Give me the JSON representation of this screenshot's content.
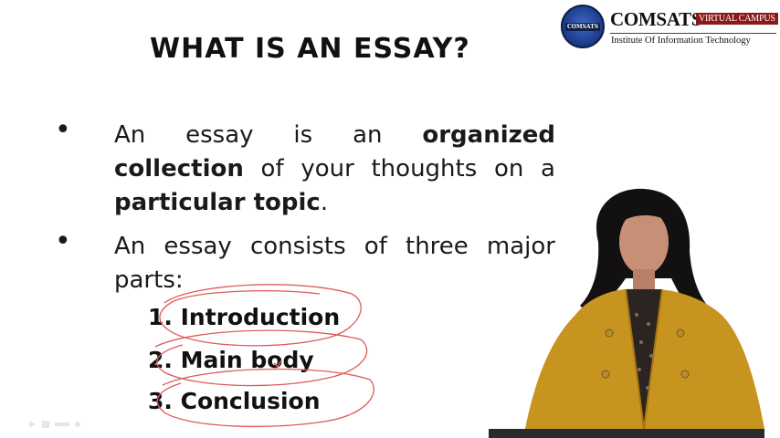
{
  "slide": {
    "title": "WHAT IS AN ESSAY?",
    "bullets": [
      {
        "pre": "An essay is an ",
        "bold1": "organized collection",
        "mid": " of your thoughts on a ",
        "bold2": "particular topic",
        "post": "."
      },
      {
        "text": "An essay consists of three major parts:"
      }
    ],
    "parts": [
      "1. Introduction",
      "2. Main body",
      "3. Conclusion"
    ]
  },
  "logo": {
    "name": "COMSATS",
    "badge": "VIRTUAL CAMPUS",
    "subtitle": "Institute Of Information Technology",
    "seal_text": "COMSATS"
  },
  "colors": {
    "annotation": "#e05a5a",
    "jacket": "#c89420",
    "logo_blue": "#1f3f8e"
  },
  "icons": [
    "bullet-dot",
    "play-icon",
    "pen-icon"
  ]
}
